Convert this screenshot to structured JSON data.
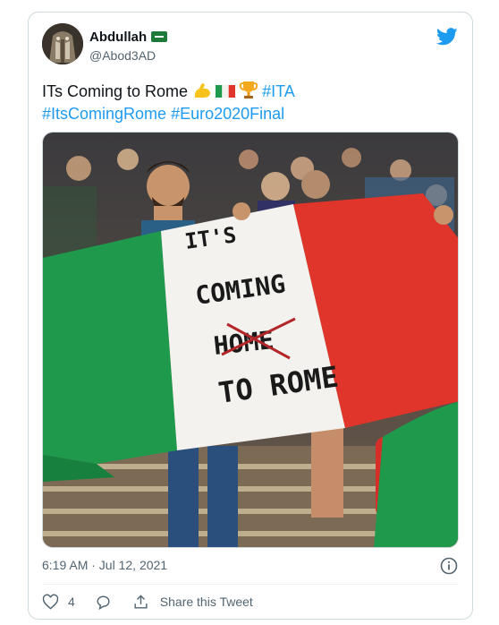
{
  "author": {
    "name": "Abdullah",
    "handle": "@Abod3AD",
    "badge": "saudi-flag-emoji"
  },
  "tweet": {
    "text_plain": "ITs Coming to Rome ",
    "hashtag_ita": "#ITA",
    "hashtag_comingrome": "#ItsComingRome",
    "hashtag_final": "#Euro2020Final",
    "emojis": [
      "flexed-biceps",
      "italian-flag",
      "trophy"
    ]
  },
  "media": {
    "flag_text_line1": "IT'S",
    "flag_text_line2": "COMING",
    "flag_text_line3": "HOME",
    "flag_text_line4": "TO ROME"
  },
  "meta": {
    "timestamp": "6:19 AM · Jul 12, 2021"
  },
  "actions": {
    "like_count": "4",
    "share_label": "Share this Tweet"
  },
  "colors": {
    "accent": "#1d9bf0",
    "text": "#0f1419",
    "muted": "#536471",
    "border": "#cfd9de",
    "flag_green": "#1f9a4c",
    "flag_white": "#f4f2ee",
    "flag_red": "#e0352b"
  }
}
